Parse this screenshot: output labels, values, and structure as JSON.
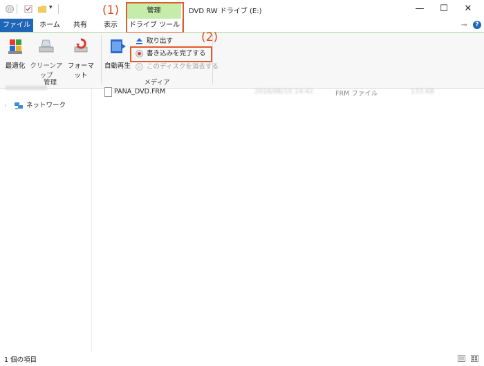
{
  "window": {
    "title": "DVD RW ドライブ (E:)",
    "controls": {
      "minimize": "—",
      "maximize": "☐",
      "close": "✕"
    }
  },
  "annotations": {
    "step1": "(1)",
    "step2": "(2)",
    "highlight_color": "#e05a2a"
  },
  "ribbon": {
    "context_group": "管理",
    "context_tab": "ドライブ ツール",
    "tabs": [
      "ファイル",
      "ホーム",
      "共有",
      "表示"
    ],
    "groups": {
      "manage": {
        "label": "管理",
        "buttons": [
          "最適化",
          "クリーンアップ",
          "フォーマット"
        ]
      },
      "media": {
        "label": "メディア",
        "autoplay": "自動再生",
        "eject": "取り出す",
        "finish_burning": "書き込みを完了する",
        "erase_disc": "このディスクを消去する"
      }
    },
    "accent": "#1f66b8",
    "context_color": "#c5ecaa"
  },
  "nav": {
    "network": "ネットワーク"
  },
  "file": {
    "name": "PANA_DVD.FRM",
    "date": "2016/06/10 14:42",
    "type": "FRM ファイル",
    "size": "133 KB"
  },
  "status": {
    "text": "1 個の項目"
  }
}
